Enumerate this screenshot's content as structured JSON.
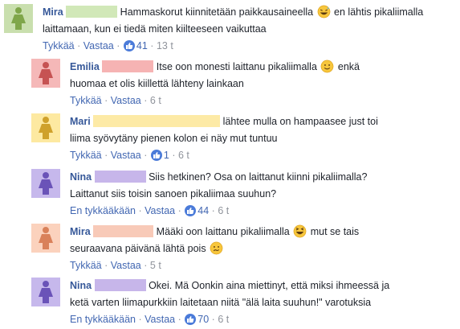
{
  "comments": [
    {
      "name": "Mira",
      "avatar_color": "#c9dfae",
      "figure_color": "#7fa64a",
      "redact_color": "#d1e8b8",
      "line1": "Hammaskorut kiinnitetään paikkausaineella",
      "line1_after": "en lähtis pikaliimalla",
      "line1_emoji": "grinning-sweat-emoji",
      "line2": "laittamaan, kun ei tiedä miten kiilteeseen vaikuttaa",
      "like": "Tykkää",
      "reply": "Vastaa",
      "reactions": "41",
      "age": "13 t"
    },
    {
      "name": "Emilia",
      "avatar_color": "#f5b8b8",
      "figure_color": "#c65353",
      "redact_color": "#f6b3b3",
      "line1": "Itse oon monesti laittanu pikaliimalla",
      "line1_after": "enkä",
      "line1_emoji": "smiling-emoji",
      "line2": "huomaa et olis kiillettä lähteny lainkaan",
      "like": "Tykkää",
      "reply": "Vastaa",
      "age": "6 t"
    },
    {
      "name": "Mari",
      "avatar_color": "#fde9a1",
      "figure_color": "#cfa12b",
      "redact_color": "#fdeaa6",
      "line1": "lähtee mulla on hampaasee just toi",
      "line2": "liima syövytäny pienen kolon ei näy mut tuntuu",
      "like": "Tykkää",
      "reply": "Vastaa",
      "reactions": "1",
      "age": "6 t"
    },
    {
      "name": "Nina",
      "avatar_color": "#c6b8ec",
      "figure_color": "#6a53b8",
      "redact_color": "#c7b6ea",
      "line1": "Siis hetkinen? Osa on laittanut kiinni pikaliimalla?",
      "line2": "Laittanut siis toisin sanoen pikaliimaa suuhun?",
      "like": "En tykkääkään",
      "reply": "Vastaa",
      "reactions": "44",
      "age": "6 t"
    },
    {
      "name": "Mira",
      "avatar_color": "#fbd2bd",
      "figure_color": "#d9815a",
      "redact_color": "#f8cab8",
      "line1": "Määki oon laittanu pikaliimalla",
      "line1_after": "mut se tais",
      "line1_emoji": "laughing-emoji",
      "line2": "seuraavana päivänä lähtä pois",
      "line2_emoji": "confused-emoji",
      "like": "Tykkää",
      "reply": "Vastaa",
      "age": "5 t"
    },
    {
      "name": "Nina",
      "avatar_color": "#c6b8ec",
      "figure_color": "#6a53b8",
      "redact_color": "#c7b6ea",
      "line1": "Okei. Mä Oonkin aina miettinyt, että miksi ihmeessä ja",
      "line2": "ketä varten liimapurkkiin laitetaan niitä \"älä laita suuhun!\" varotuksia",
      "like": "En tykkääkään",
      "reply": "Vastaa",
      "reactions": "70",
      "age": "6 t"
    }
  ]
}
